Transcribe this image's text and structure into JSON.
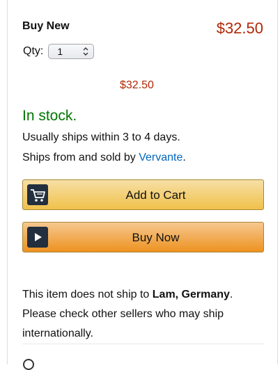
{
  "offer": {
    "condition_label": "Buy New",
    "price": "$32.50",
    "qty_label": "Qty:",
    "qty_value": "1",
    "price_secondary": "$32.50",
    "availability": "In stock.",
    "ships_within": "Usually ships within 3 to 4 days.",
    "ships_from_prefix": "Ships from and sold by ",
    "seller_name": "Vervante",
    "seller_suffix": "."
  },
  "buttons": {
    "add_to_cart": "Add to Cart",
    "buy_now": "Buy Now"
  },
  "shipping_notice": {
    "prefix": "This item does not ship to ",
    "location": "Lam, Germany",
    "suffix": ". Please check other sellers who may ship internationally."
  },
  "colors": {
    "price": "#b12704",
    "in_stock": "#007600",
    "link": "#0066c0",
    "cart_button": "#f0c14b",
    "buy_button": "#ed9220",
    "icon_bg": "#232f3e"
  },
  "icons": {
    "cart": "shopping-cart-icon",
    "buy": "play-icon",
    "qty": "chevron-up-down-icon",
    "bottom": "location-pin-icon"
  }
}
